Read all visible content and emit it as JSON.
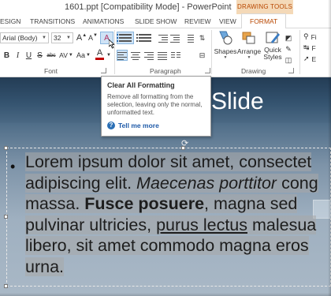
{
  "window": {
    "title": "1601.ppt [Compatibility Mode] - PowerPoint",
    "contextual_group": "DRAWING TOOLS"
  },
  "tabs": [
    "ESIGN",
    "TRANSITIONS",
    "ANIMATIONS",
    "SLIDE SHOW",
    "REVIEW",
    "VIEW",
    "FORMAT"
  ],
  "ribbon": {
    "font_name": "Arial (Body)",
    "font_size": "32",
    "clear_formatting_glyph": "A",
    "bold_glyph": "B",
    "italic_glyph": "I",
    "underline_glyph": "U",
    "strike_glyph": "S",
    "abc_glyph": "abc",
    "av_glyph": "AV",
    "case_glyph": "Aa",
    "grow_glyph": "A",
    "shrink_glyph": "A",
    "font_color_glyph": "A",
    "groups": {
      "font": "Font",
      "paragraph": "Paragraph",
      "drawing": "Drawing"
    },
    "drawing_buttons": {
      "shapes": "Shapes",
      "arrange": "Arrange",
      "quick_styles_1": "Quick",
      "quick_styles_2": "Styles"
    },
    "right_partial": [
      "Fi",
      "F",
      "E"
    ],
    "colors": {
      "accent": "#b84700",
      "font_color_bar": "#c00000",
      "highlight": "#cfe3f6"
    }
  },
  "tooltip": {
    "title": "Clear All Formatting",
    "description": "Remove all formatting from the selection, leaving only the normal, unformatted text.",
    "help_link": "Tell me more"
  },
  "slide": {
    "title": "Slide",
    "bullet": "•",
    "body": {
      "l1": "Lorem ipsum dolor sit amet, consectet",
      "l2a": "adipiscing elit. ",
      "l2b": "Maecenas porttitor",
      "l2c": " cong",
      "l3a": "massa. ",
      "l3b": "Fusce posuere",
      "l3c": ", magna sed",
      "l4a": "pulvinar ultricies, ",
      "l4b": "purus lectus",
      "l4c": " malesua",
      "l5": "libero, sit amet commodo magna eros",
      "l6": "urna."
    }
  }
}
